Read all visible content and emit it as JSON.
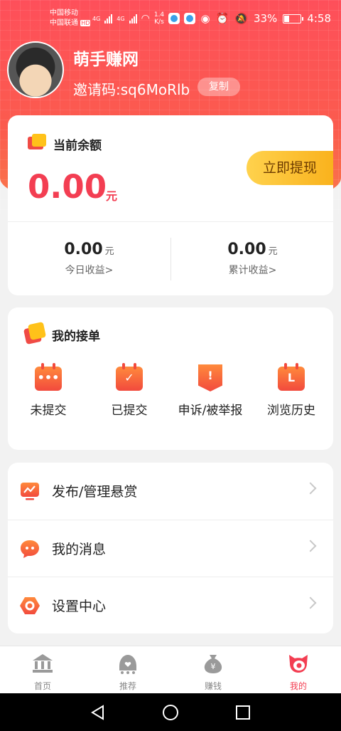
{
  "status_bar": {
    "carrier1": "中国移动",
    "carrier2": "中国联通",
    "hd": "HD",
    "net1": "4G",
    "net2": "4G",
    "speed_value": "1.4",
    "speed_unit": "K/s",
    "battery": "33%",
    "time": "4:58"
  },
  "profile": {
    "app_name": "萌手赚网",
    "invite_code": "邀请码:sq6MoRlb",
    "copy_label": "复制"
  },
  "balance": {
    "title": "当前余额",
    "value": "0.00",
    "unit": "元",
    "withdraw_label": "立即提现",
    "today_value": "0.00",
    "today_unit": "元",
    "today_label": "今日收益>",
    "total_value": "0.00",
    "total_unit": "元",
    "total_label": "累计收益>"
  },
  "orders": {
    "title": "我的接单",
    "items": [
      {
        "label": "未提交",
        "glyph": "•••"
      },
      {
        "label": "已提交",
        "glyph": "✓"
      },
      {
        "label": "申诉/被举报",
        "glyph": "!"
      },
      {
        "label": "浏览历史",
        "glyph": "L"
      }
    ]
  },
  "menu": {
    "items": [
      {
        "label": "发布/管理悬赏",
        "icon": "chart-screen-icon"
      },
      {
        "label": "我的消息",
        "icon": "chat-bubble-icon"
      },
      {
        "label": "设置中心",
        "icon": "settings-hexagon-icon"
      }
    ]
  },
  "tabs": [
    {
      "label": "首页",
      "icon": "home-bank-icon"
    },
    {
      "label": "推荐",
      "icon": "recommend-icon"
    },
    {
      "label": "赚钱",
      "icon": "money-bag-icon"
    },
    {
      "label": "我的",
      "icon": "profile-cat-icon",
      "active": true
    }
  ],
  "colors": {
    "accent": "#f33e52",
    "header": "#fe4f5a",
    "withdraw": "#ffc21a"
  }
}
